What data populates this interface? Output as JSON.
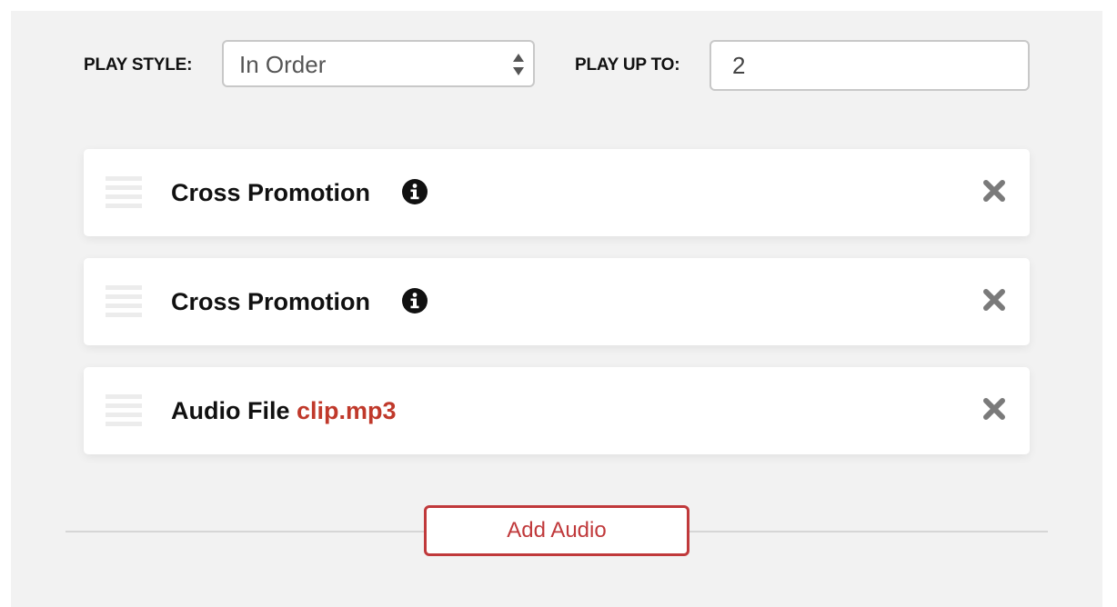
{
  "controls": {
    "play_style_label": "PLAY STYLE:",
    "play_style_value": "In Order",
    "play_up_to_label": "PLAY UP TO:",
    "play_up_to_value": "2"
  },
  "items": [
    {
      "title": "Cross Promotion",
      "file": "",
      "has_info": true
    },
    {
      "title": "Cross Promotion",
      "file": "",
      "has_info": true
    },
    {
      "title": "Audio File",
      "file": "clip.mp3",
      "has_info": false
    }
  ],
  "footer": {
    "add_audio_label": "Add Audio"
  },
  "colors": {
    "accent": "#c0393b",
    "panel_background": "#f2f2f2",
    "icon_gray": "#7a7a7a"
  },
  "icons": {
    "drag": "drag-handle-icon",
    "info": "info-icon",
    "remove": "close-icon",
    "select": "chevron-updown-icon"
  }
}
